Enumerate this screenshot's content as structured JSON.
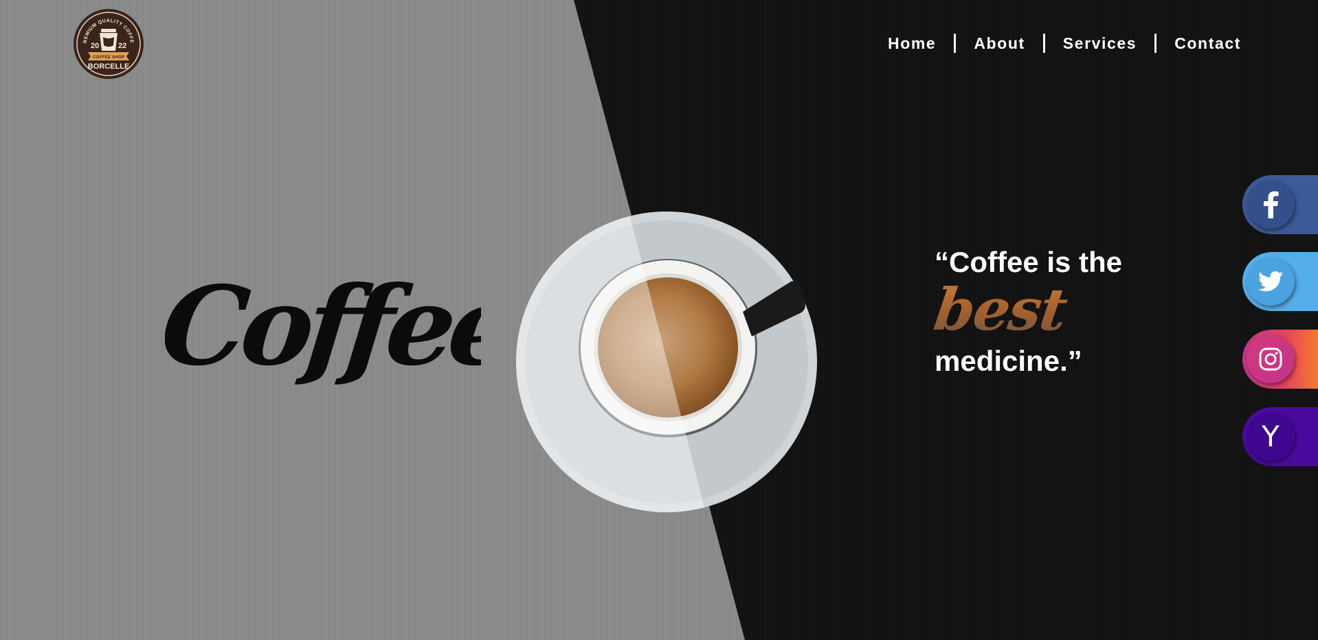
{
  "header": {
    "logo": {
      "top_text": "PREMIUM QUALITY COFFEE",
      "year_left": "20",
      "year_right": "22",
      "ribbon_text": "COFFEE SHOP",
      "brand": "BORCELLE"
    },
    "nav": [
      {
        "label": "Home"
      },
      {
        "label": "About"
      },
      {
        "label": "Services"
      },
      {
        "label": "Contact"
      }
    ]
  },
  "hero": {
    "title": "Coffee"
  },
  "quote": {
    "line1": "“Coffee is the",
    "highlight": "best",
    "line2": "medicine.”"
  },
  "social": [
    {
      "name": "Facebook",
      "icon": "facebook-icon",
      "color": "#3d5a98"
    },
    {
      "name": "Twitter",
      "icon": "twitter-icon",
      "color": "#54aeea"
    },
    {
      "name": "Instagram",
      "icon": "instagram-icon",
      "color": "#e6415f"
    },
    {
      "name": "Yahoo",
      "icon": "yahoo-icon",
      "color": "#4a0a9e",
      "glyph": "Y"
    }
  ],
  "colors": {
    "left_panel": "#8b8b8b",
    "right_panel": "#121212",
    "accent_brown": "#a9622a"
  }
}
